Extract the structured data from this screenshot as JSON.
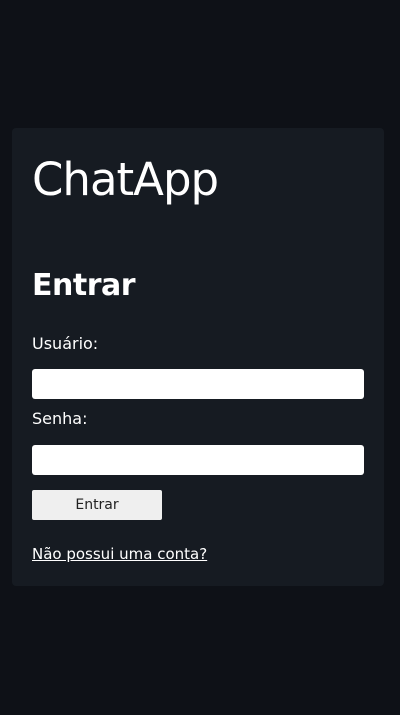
{
  "app": {
    "title": "ChatApp"
  },
  "login": {
    "heading": "Entrar",
    "username_label": "Usuário:",
    "username_value": "",
    "password_label": "Senha:",
    "password_value": "",
    "submit_label": "Entrar",
    "register_link": "Não possui uma conta?"
  },
  "colors": {
    "page_background": "#0e1117",
    "card_background": "#161b22",
    "text": "#ffffff",
    "input_background": "#ffffff",
    "button_background": "#efefef"
  }
}
